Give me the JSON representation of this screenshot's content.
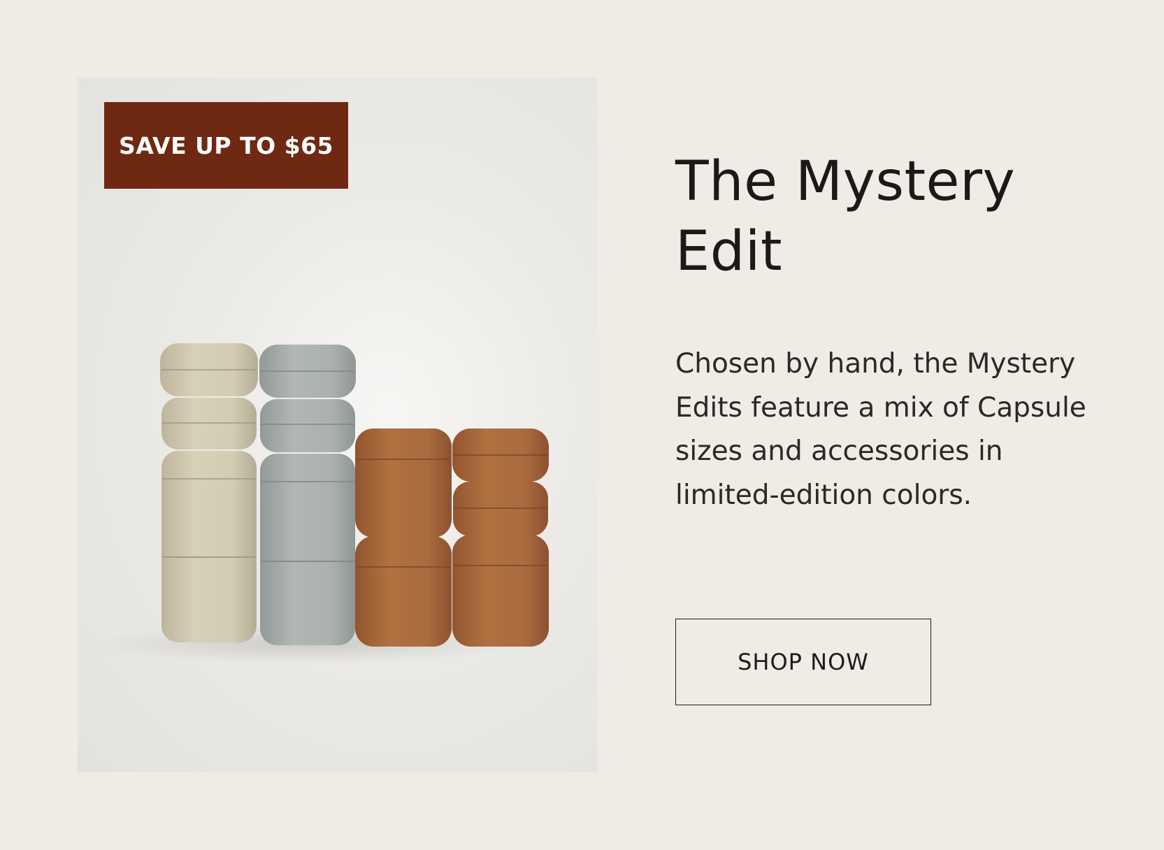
{
  "promo": {
    "badge_text": "SAVE UP TO $65",
    "title": "The Mystery Edit",
    "description": "Chosen by hand, the Mystery Edits feature a mix of Capsule sizes and accessories in limited-edition colors.",
    "cta_label": "SHOP NOW"
  },
  "colors": {
    "page_background": "#efebe5",
    "badge_background": "#6f2912",
    "text": "#1d1c1a",
    "capsule_cream": "#cfc7ae",
    "capsule_sage": "#a7aeab",
    "capsule_terracotta": "#a8693f"
  },
  "image": {
    "subject": "product-photo-stacked-capsules"
  }
}
